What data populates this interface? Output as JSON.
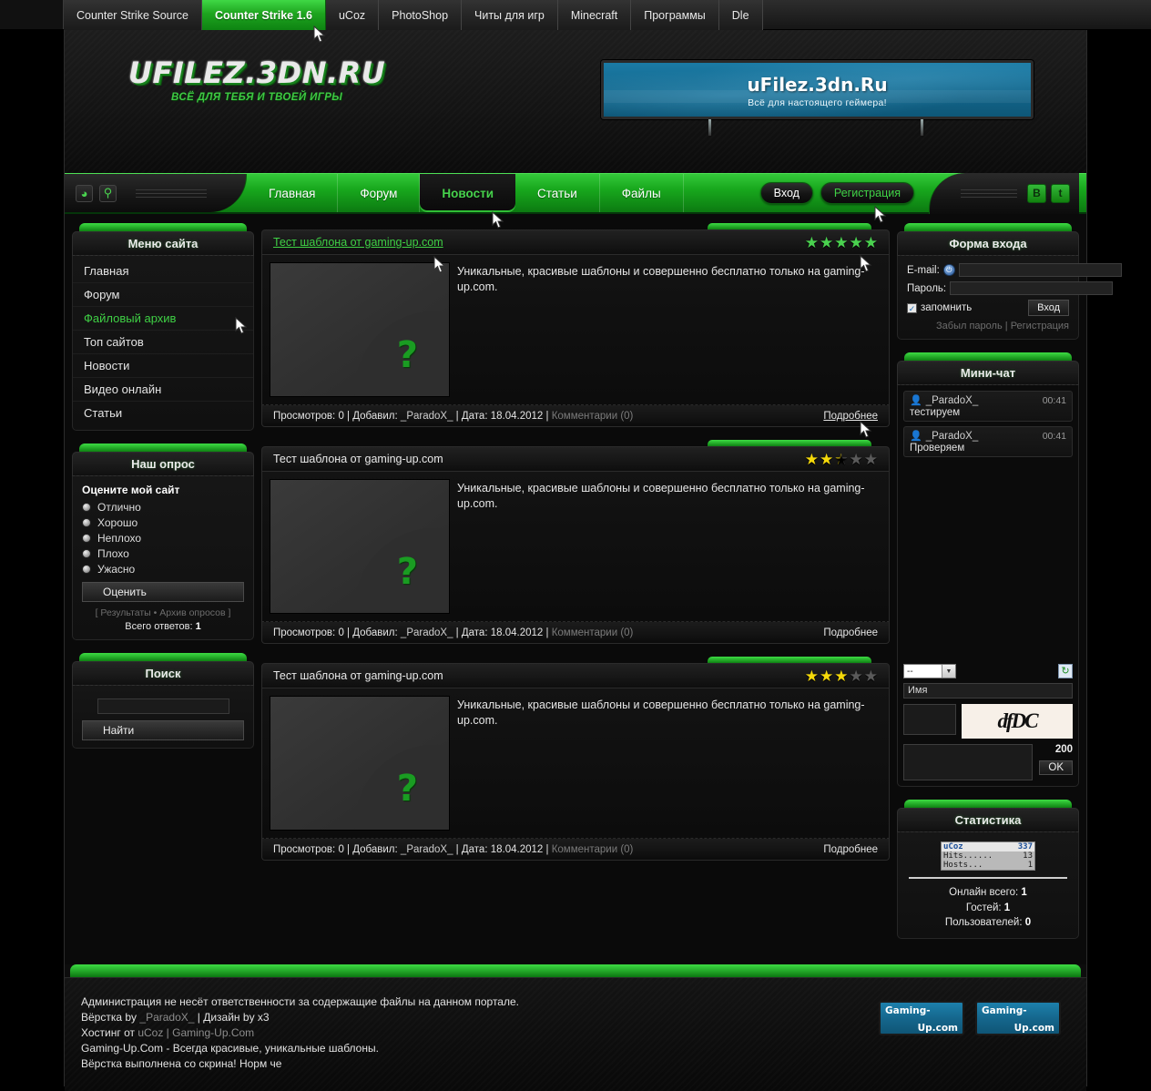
{
  "browser_tabs": [
    {
      "label": "Counter Strike Source",
      "active": false
    },
    {
      "label": "Counter Strike 1.6",
      "active": true
    },
    {
      "label": "uCoz",
      "active": false
    },
    {
      "label": "PhotoShop",
      "active": false
    },
    {
      "label": "Читы для игр",
      "active": false
    },
    {
      "label": "Minecraft",
      "active": false
    },
    {
      "label": "Программы",
      "active": false
    },
    {
      "label": "Dle",
      "active": false
    }
  ],
  "header": {
    "logo_main": "UFILEZ.3DN.RU",
    "logo_sub": "ВСЁ ДЛЯ ТЕБЯ И ТВОЕЙ ИГРЫ",
    "banner_title": "uFilez.3dn.Ru",
    "banner_subtitle": "Всё для настоящего геймера!"
  },
  "nav": {
    "items": [
      {
        "label": "Главная",
        "active": false
      },
      {
        "label": "Форум",
        "active": false
      },
      {
        "label": "Новости",
        "active": true
      },
      {
        "label": "Статьи",
        "active": false
      },
      {
        "label": "Файлы",
        "active": false
      }
    ],
    "login_button": "Вход",
    "register_button": "Регистрация",
    "social": [
      {
        "label": "B"
      },
      {
        "label": "t"
      }
    ],
    "rss_icon": "rss-icon",
    "search_icon": "search-icon"
  },
  "sidebar": {
    "menu": {
      "title": "Меню сайта",
      "items": [
        {
          "label": "Главная",
          "hover": false
        },
        {
          "label": "Форум",
          "hover": false
        },
        {
          "label": "Файловый архив",
          "hover": true
        },
        {
          "label": "Топ сайтов",
          "hover": false
        },
        {
          "label": "Новости",
          "hover": false
        },
        {
          "label": "Видео онлайн",
          "hover": false
        },
        {
          "label": "Статьи",
          "hover": false
        }
      ]
    },
    "poll": {
      "title": "Наш опрос",
      "question": "Оцените мой сайт",
      "options": [
        "Отлично",
        "Хорошо",
        "Неплохо",
        "Плохо",
        "Ужасно"
      ],
      "submit": "Оценить",
      "links": "[ Результаты • Архив опросов ]",
      "total_label": "Всего ответов:",
      "total_value": "1"
    },
    "search": {
      "title": "Поиск",
      "value": "",
      "button": "Найти"
    }
  },
  "entries": [
    {
      "title": "Тест шаблона от gaming-up.com",
      "title_is_link": true,
      "rating": 5,
      "star_color": "green",
      "text": "Уникальные, красивые шаблоны и совершенно бесплатно только на gaming-up.com.",
      "views_label": "Просмотров:",
      "views": "0",
      "author_label": "Добавил:",
      "author": "_ParadoX_",
      "date_label": "Дата:",
      "date": "18.04.2012",
      "comments": "Комментарии (0)",
      "more": "Подробнее",
      "more_underline": true,
      "thumb_placeholder": "?"
    },
    {
      "title": "Тест шаблона от gaming-up.com",
      "title_is_link": false,
      "rating": 2.5,
      "star_color": "yellow",
      "text": "Уникальные, красивые шаблоны и совершенно бесплатно только на gaming-up.com.",
      "views_label": "Просмотров:",
      "views": "0",
      "author_label": "Добавил:",
      "author": "_ParadoX_",
      "date_label": "Дата:",
      "date": "18.04.2012",
      "comments": "Комментарии (0)",
      "more": "Подробнее",
      "more_underline": false,
      "thumb_placeholder": "?"
    },
    {
      "title": "Тест шаблона от gaming-up.com",
      "title_is_link": false,
      "rating": 3,
      "star_color": "yellow",
      "text": "Уникальные, красивые шаблоны и совершенно бесплатно только на gaming-up.com.",
      "views_label": "Просмотров:",
      "views": "0",
      "author_label": "Добавил:",
      "author": "_ParadoX_",
      "date_label": "Дата:",
      "date": "18.04.2012",
      "comments": "Комментарии (0)",
      "more": "Подробнее",
      "more_underline": false,
      "thumb_placeholder": "?"
    }
  ],
  "login_form": {
    "title": "Форма входа",
    "email_label": "E-mail:",
    "email_value": "",
    "uid_icon": "uid-icon",
    "password_label": "Пароль:",
    "password_value": "",
    "remember_label": "запомнить",
    "remember_checked": true,
    "submit": "Вход",
    "forgot_link": "Забыл пароль",
    "separator": "|",
    "register_link": "Регистрация"
  },
  "minichat": {
    "title": "Мини-чат",
    "messages": [
      {
        "user": "_ParadoX_",
        "time": "00:41",
        "text": "тестируем"
      },
      {
        "user": "_ParadoX_",
        "time": "00:41",
        "text": "Проверяем"
      }
    ],
    "smiley_select": "--",
    "refresh_icon": "refresh-icon",
    "name_placeholder": "Имя",
    "name_value": "",
    "captcha_text": "dfDC",
    "captcha_value": "",
    "message_value": "",
    "char_counter": "200",
    "submit": "OK"
  },
  "stats": {
    "title": "Статистика",
    "counter_brand": "uCoz",
    "counter_total": "337",
    "hits_label": "Hits......",
    "hits": "13",
    "hosts_label": "Hosts...",
    "hosts": "1",
    "online_label": "Онлайн всего:",
    "online": "1",
    "guests_label": "Гостей:",
    "guests": "1",
    "users_label": "Пользователей:",
    "users": "0"
  },
  "footer": {
    "line1": "Администрация не несёт ответственности за содержащие файлы на данном портале.",
    "line2_a": "Вёрстка by ",
    "line2_user": "_ParadoX_",
    "line2_b": " | Дизайн by x3",
    "line3_a": "Хостинг от ",
    "line3_ucoz": "uCoz",
    "line3_sep": " | ",
    "line3_gup": "Gaming-Up.Com",
    "line4": "Gaming-Up.Com - Всегда красивые, уникальные шаблоны.",
    "line5": "Вёрстка выполнена со скрина! Норм че",
    "banners": [
      {
        "top": "Gaming-",
        "bottom": "Up.com"
      },
      {
        "top": "Gaming-",
        "bottom": "Up.com"
      }
    ]
  },
  "colors": {
    "accent_green": "#3fd145",
    "bright_green": "#3ddc43",
    "star_yellow": "#f5d90a",
    "banner_blue": "#15678d"
  }
}
